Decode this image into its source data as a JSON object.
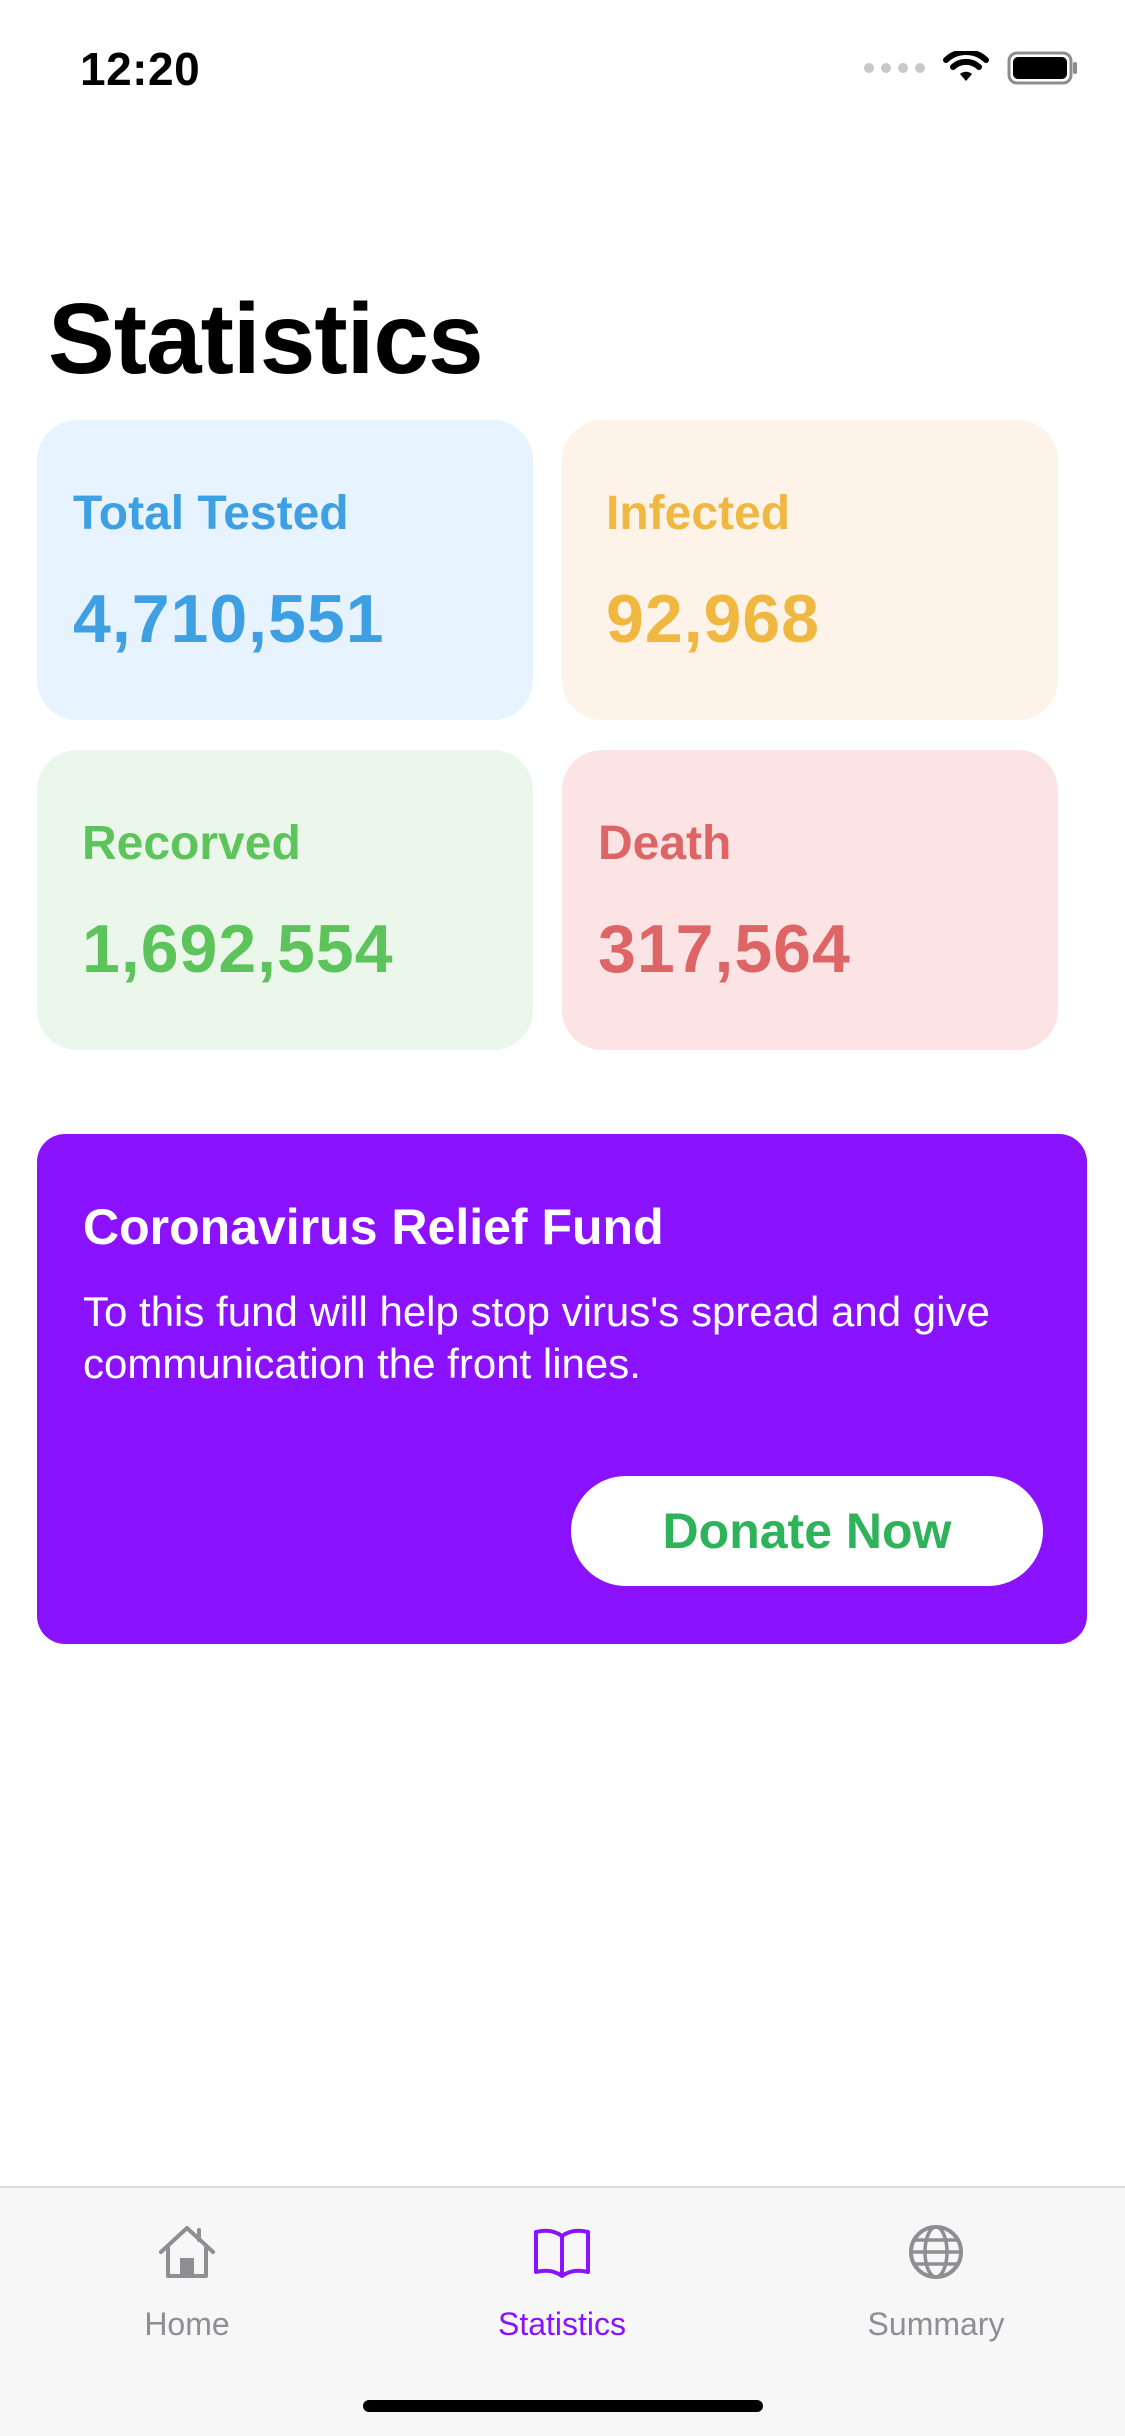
{
  "status_bar": {
    "time": "12:20"
  },
  "page": {
    "title": "Statistics"
  },
  "stats": [
    {
      "label": "Total Tested",
      "value": "4,710,551"
    },
    {
      "label": "Infected",
      "value": "92,968"
    },
    {
      "label": "Recorved",
      "value": "1,692,554"
    },
    {
      "label": "Death",
      "value": "317,564"
    }
  ],
  "fund": {
    "title": "Coronavirus Relief Fund",
    "description": "To this fund will help stop virus's spread and give communication the front lines.",
    "button_label": "Donate Now"
  },
  "tab_bar": {
    "items": [
      {
        "label": "Home",
        "icon": "home-icon"
      },
      {
        "label": "Statistics",
        "icon": "book-icon"
      },
      {
        "label": "Summary",
        "icon": "globe-icon"
      }
    ],
    "active": "Statistics"
  },
  "colors": {
    "accent": "#8b12ff",
    "tested": "#3f9fe3",
    "infected": "#f0b840",
    "recovered": "#5cc45a",
    "death": "#dd6565",
    "donate_text": "#2fb35a"
  }
}
